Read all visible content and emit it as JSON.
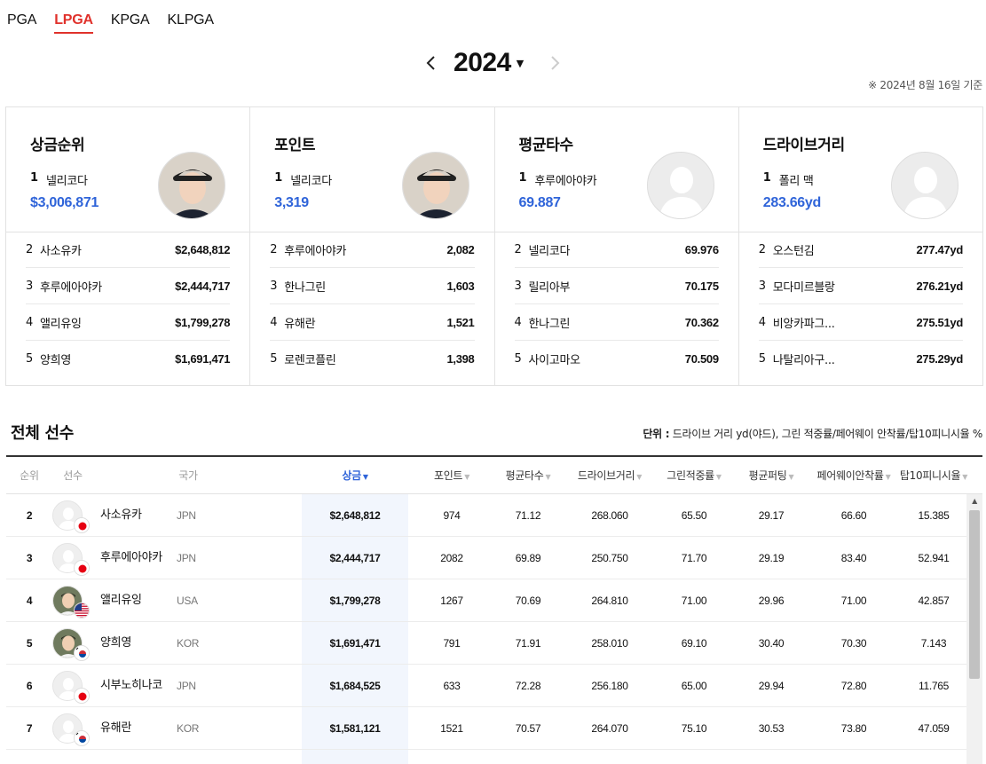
{
  "tours": [
    {
      "label": "PGA",
      "active": false
    },
    {
      "label": "LPGA",
      "active": true
    },
    {
      "label": "KPGA",
      "active": false
    },
    {
      "label": "KLPGA",
      "active": false
    }
  ],
  "season": {
    "year": "2024",
    "basis": "※ 2024년 8월 16일 기준"
  },
  "leaders": [
    {
      "title": "상금순위",
      "top": {
        "rank": "1",
        "name": "넬리코다",
        "value": "$3,006,871",
        "photo": "player-photo"
      },
      "list": [
        {
          "rank": "2",
          "name": "사소유카",
          "value": "$2,648,812"
        },
        {
          "rank": "3",
          "name": "후루에아야카",
          "value": "$2,444,717"
        },
        {
          "rank": "4",
          "name": "앨리유잉",
          "value": "$1,799,278"
        },
        {
          "rank": "5",
          "name": "양희영",
          "value": "$1,691,471"
        }
      ]
    },
    {
      "title": "포인트",
      "top": {
        "rank": "1",
        "name": "넬리코다",
        "value": "3,319",
        "photo": "player-photo"
      },
      "list": [
        {
          "rank": "2",
          "name": "후루에아야카",
          "value": "2,082"
        },
        {
          "rank": "3",
          "name": "한나그린",
          "value": "1,603"
        },
        {
          "rank": "4",
          "name": "유해란",
          "value": "1,521"
        },
        {
          "rank": "5",
          "name": "로렌코플린",
          "value": "1,398"
        }
      ]
    },
    {
      "title": "평균타수",
      "top": {
        "rank": "1",
        "name": "후루에아야카",
        "value": "69.887",
        "photo": "placeholder"
      },
      "list": [
        {
          "rank": "2",
          "name": "넬리코다",
          "value": "69.976"
        },
        {
          "rank": "3",
          "name": "릴리아부",
          "value": "70.175"
        },
        {
          "rank": "4",
          "name": "한나그린",
          "value": "70.362"
        },
        {
          "rank": "5",
          "name": "사이고마오",
          "value": "70.509"
        }
      ]
    },
    {
      "title": "드라이브거리",
      "top": {
        "rank": "1",
        "name": "폴리 맥",
        "value": "283.66yd",
        "photo": "placeholder"
      },
      "list": [
        {
          "rank": "2",
          "name": "오스턴김",
          "value": "277.47yd"
        },
        {
          "rank": "3",
          "name": "모다미르블랑",
          "value": "276.21yd"
        },
        {
          "rank": "4",
          "name": "비앙카파그...",
          "value": "275.51yd"
        },
        {
          "rank": "5",
          "name": "나탈리아구...",
          "value": "275.29yd"
        }
      ]
    }
  ],
  "all_players": {
    "title": "전체 선수",
    "unit_label": "단위 :",
    "unit_text": " 드라이브 거리 yd(야드), 그린 적중률/페어웨이 안착률/탑10피니시율 %",
    "columns": {
      "rank": "순위",
      "player": "선수",
      "country": "국가",
      "prize": "상금",
      "points": "포인트",
      "avg_score": "평균타수",
      "drive": "드라이브거리",
      "gir": "그린적중률",
      "putting": "평균퍼팅",
      "fairway": "페어웨이안착률",
      "top10": "탑10피니시율"
    },
    "rows": [
      {
        "rank": "2",
        "name": "사소유카",
        "country": "JPN",
        "flag": "japan",
        "photo": "placeholder",
        "prize": "$2,648,812",
        "points": "974",
        "avg": "71.12",
        "drive": "268.060",
        "gir": "65.50",
        "putt": "29.17",
        "fairway": "66.60",
        "top10": "15.385"
      },
      {
        "rank": "3",
        "name": "후루에아야카",
        "country": "JPN",
        "flag": "japan",
        "photo": "placeholder",
        "prize": "$2,444,717",
        "points": "2082",
        "avg": "69.89",
        "drive": "250.750",
        "gir": "71.70",
        "putt": "29.19",
        "fairway": "83.40",
        "top10": "52.941"
      },
      {
        "rank": "4",
        "name": "앨리유잉",
        "country": "USA",
        "flag": "usa",
        "photo": "player-photo",
        "prize": "$1,799,278",
        "points": "1267",
        "avg": "70.69",
        "drive": "264.810",
        "gir": "71.00",
        "putt": "29.96",
        "fairway": "71.00",
        "top10": "42.857"
      },
      {
        "rank": "5",
        "name": "양희영",
        "country": "KOR",
        "flag": "korea",
        "photo": "player-photo",
        "prize": "$1,691,471",
        "points": "791",
        "avg": "71.91",
        "drive": "258.010",
        "gir": "69.10",
        "putt": "30.40",
        "fairway": "70.30",
        "top10": "7.143"
      },
      {
        "rank": "6",
        "name": "시부노히나코",
        "country": "JPN",
        "flag": "japan",
        "photo": "placeholder",
        "prize": "$1,684,525",
        "points": "633",
        "avg": "72.28",
        "drive": "256.180",
        "gir": "65.00",
        "putt": "29.94",
        "fairway": "72.80",
        "top10": "11.765"
      },
      {
        "rank": "7",
        "name": "유해란",
        "country": "KOR",
        "flag": "korea",
        "photo": "placeholder",
        "prize": "$1,581,121",
        "points": "1521",
        "avg": "70.57",
        "drive": "264.070",
        "gir": "75.10",
        "putt": "30.53",
        "fairway": "73.80",
        "top10": "47.059"
      }
    ]
  }
}
